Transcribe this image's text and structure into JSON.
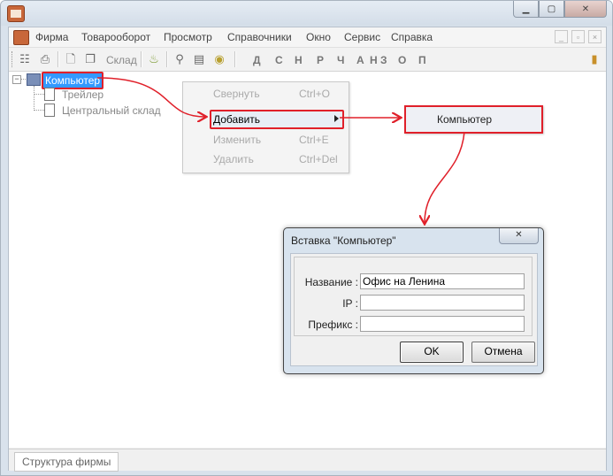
{
  "menubar": {
    "items": [
      "Фирма",
      "Товарооборот",
      "Просмотр",
      "Справочники",
      "Окно",
      "Сервис",
      "Справка"
    ]
  },
  "toolbar": {
    "sklad_label": "Склад",
    "letters": [
      "Д",
      "С",
      "Н",
      "Р",
      "Ч",
      "А",
      "Н",
      "З",
      "О",
      "П"
    ]
  },
  "tree": {
    "root": "Компьютер",
    "children": [
      "Трейлер",
      "Центральный склад"
    ]
  },
  "context_menu": {
    "items": [
      {
        "label": "Свернуть",
        "shortcut": "Ctrl+O"
      },
      {
        "label": "Добавить",
        "shortcut": ""
      },
      {
        "label": "Изменить",
        "shortcut": "Ctrl+E"
      },
      {
        "label": "Удалить",
        "shortcut": "Ctrl+Del"
      }
    ]
  },
  "submenu": {
    "item": "Компьютер"
  },
  "dialog": {
    "title": "Вставка \"Компьютер\"",
    "fields": [
      {
        "label": "Название :",
        "value": "Офис на Ленина"
      },
      {
        "label": "IP :",
        "value": ""
      },
      {
        "label": "Префикс :",
        "value": ""
      }
    ],
    "ok_label": "OK",
    "cancel_label": "Отмена"
  },
  "status": {
    "tab": "Структура фирмы"
  },
  "colors": {
    "highlight": "#e0202a",
    "selection": "#3399ff"
  }
}
